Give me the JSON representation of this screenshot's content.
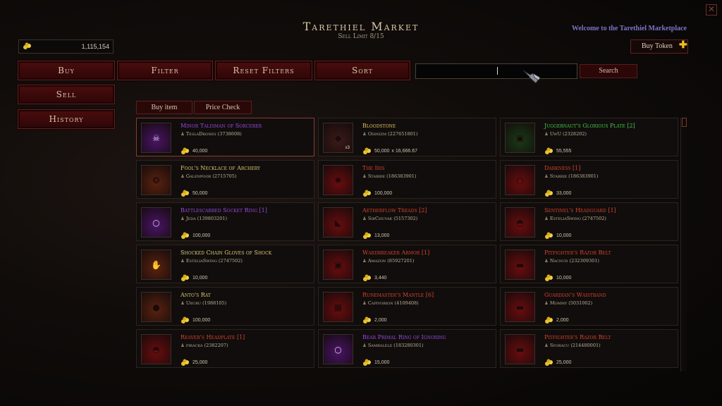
{
  "header": {
    "title": "Tarethiel Market",
    "sell_limit": "Sell Limit 8/15",
    "welcome": "Welcome to the Tarethiel Marketplace"
  },
  "currency": {
    "gold": "1,115,154"
  },
  "buy_token": {
    "label": "Buy Token"
  },
  "nav": {
    "buy": "Buy",
    "filter": "Filter",
    "reset_filters": "Reset Filters",
    "sort": "Sort",
    "sell": "Sell",
    "history": "History"
  },
  "search": {
    "value": "",
    "button": "Search"
  },
  "tabs": {
    "buy_item": "Buy item",
    "price_check": "Price Check"
  },
  "colors": {
    "magic": "#9a4adf",
    "rare": "#e0c878",
    "unique": "#e8c060",
    "set": "#46c846",
    "legendary": "#d8422e",
    "crafted": "#e8b040"
  },
  "listings": [
    {
      "name": "Minor Talisman of Sorcerer",
      "seller": "TeslaDrones (3738608)",
      "price": "40,000",
      "rarity": "magic",
      "icon": "skull-icon",
      "selected": true
    },
    {
      "name": "Bloodstone",
      "seller": "Odinizm (227651801)",
      "price": "50,000",
      "unit": "x 16,666.67",
      "qty": "x3",
      "rarity": "unique",
      "icon": "gem-icon"
    },
    {
      "name": "Juggernaut's Glorious Plate [2]",
      "seller": "UwU (2328202)",
      "price": "55,555",
      "rarity": "set",
      "icon": "armor-icon"
    },
    {
      "name": "Fool's Necklace of Archery",
      "seller": "Galenpoor (2715705)",
      "price": "50,000",
      "rarity": "rare",
      "icon": "necklace-icon"
    },
    {
      "name": "The Iris",
      "seller": "Starrie (186383901)",
      "price": "100,000",
      "rarity": "legendary",
      "icon": "staff-icon"
    },
    {
      "name": "Darkness [1]",
      "seller": "Starrie (186383901)",
      "price": "33,000",
      "rarity": "legendary",
      "icon": "ring-icon"
    },
    {
      "name": "Battlescarred Socket Ring [1]",
      "seller": "Jeda (139803201)",
      "price": "100,000",
      "rarity": "magic",
      "icon": "ring-icon"
    },
    {
      "name": "Aetherflow Treads [2]",
      "seller": "SirChuvak (5157302)",
      "price": "13,000",
      "rarity": "legendary",
      "icon": "boots-icon"
    },
    {
      "name": "Sentinel's Headguard [1]",
      "seller": "EsteliaSwing (2747502)",
      "price": "10,000",
      "rarity": "legendary",
      "icon": "helmet-icon"
    },
    {
      "name": "Shocked Chain Gloves of Shock",
      "seller": "EsteliaSwing (2747502)",
      "price": "10,000",
      "rarity": "rare",
      "icon": "gloves-icon"
    },
    {
      "name": "Wardbreaker Armor [1]",
      "seller": "Amazon (85927201)",
      "price": "3,440",
      "rarity": "legendary",
      "icon": "armor-icon"
    },
    {
      "name": "Pitfighter's Razor Belt",
      "seller": "Nacnud (232309301)",
      "price": "10,000",
      "rarity": "legendary",
      "icon": "belt-icon"
    },
    {
      "name": "Anto's Rat",
      "seller": "Ububu (1988105)",
      "price": "100,000",
      "rarity": "rare",
      "icon": "rat-icon"
    },
    {
      "name": "Runemaster's Mantle [6]",
      "seller": "Capivorion (4109408)",
      "price": "2,000",
      "rarity": "legendary",
      "icon": "mantle-icon"
    },
    {
      "name": "Guardian's Waistband",
      "seller": "Mommy (5031002)",
      "price": "2,000",
      "rarity": "legendary",
      "icon": "belt-icon"
    },
    {
      "name": "Reaver's Headplate [1]",
      "seller": "piracka (2382207)",
      "price": "25,000",
      "rarity": "legendary",
      "icon": "helmet-icon"
    },
    {
      "name": "Bear Primal Ring of Ignoring",
      "seller": "Sambalele (183280301)",
      "price": "15,000",
      "rarity": "magic",
      "icon": "ring-icon"
    },
    {
      "name": "Pitfighter's Razor Belt",
      "seller": "Sforacu (214480001)",
      "price": "25,000",
      "rarity": "legendary",
      "icon": "belt-icon"
    }
  ]
}
